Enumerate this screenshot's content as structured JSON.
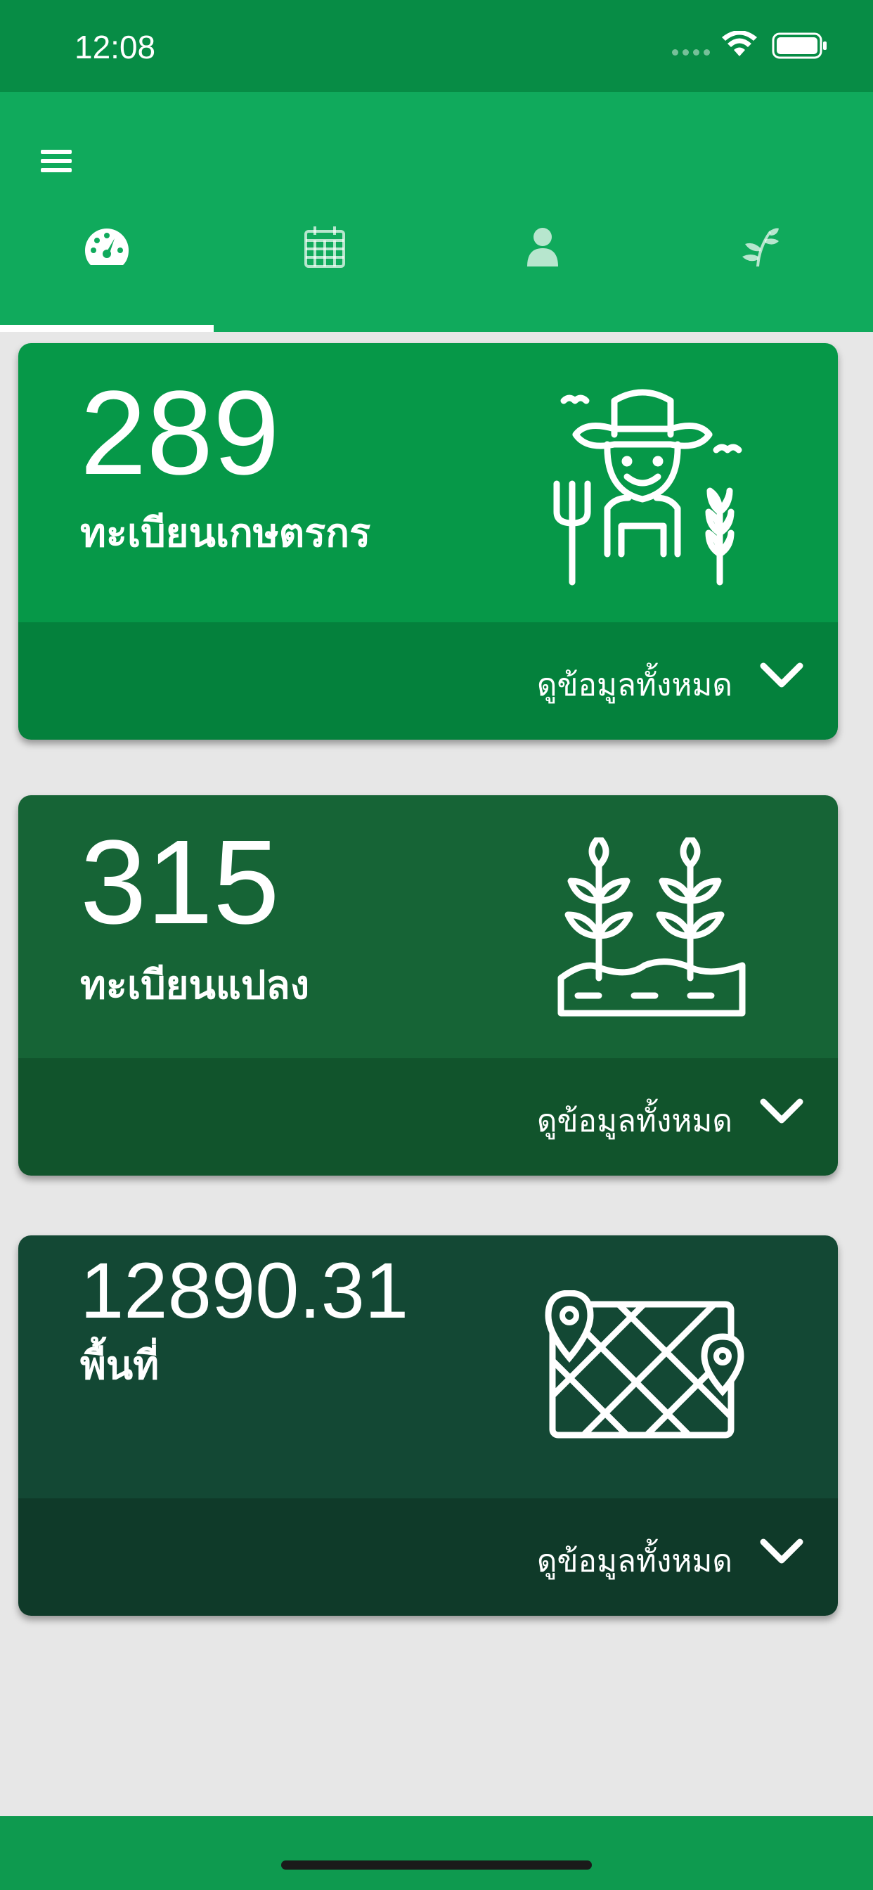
{
  "status": {
    "time": "12:08"
  },
  "tabs": [
    {
      "icon": "dashboard-gauge-icon",
      "active": true
    },
    {
      "icon": "calendar-icon",
      "active": false
    },
    {
      "icon": "person-icon",
      "active": false
    },
    {
      "icon": "plant-sprout-icon",
      "active": false
    }
  ],
  "cards": [
    {
      "value": "289",
      "label": "ทะเบียนเกษตรกร",
      "footer": "ดูข้อมูลทั้งหมด",
      "icon": "farmer-icon",
      "color_top": "#069848",
      "color_footer": "#04813c"
    },
    {
      "value": "315",
      "label": "ทะเบียนแปลง",
      "footer": "ดูข้อมูลทั้งหมด",
      "icon": "crop-plot-icon",
      "color_top": "#166436",
      "color_footer": "#11542c"
    },
    {
      "value": "12890.31",
      "label": "พื้นที่",
      "footer": "ดูข้อมูลทั้งหมด",
      "icon": "map-pins-icon",
      "color_top": "#134834",
      "color_footer": "#0f3a29"
    }
  ],
  "colors": {
    "status_bar": "#078c45",
    "app_bar": "#10aa5c",
    "background": "#e7e7e7",
    "bottom_bar": "#0e9a4f"
  }
}
